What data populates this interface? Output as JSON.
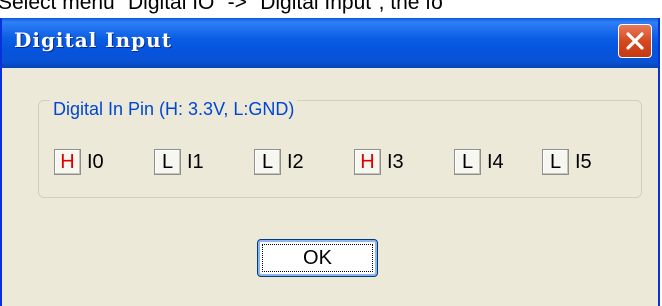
{
  "caption": {
    "text": "Select menu \"Digital IO\" -> \"Digital Input\", the fo"
  },
  "window": {
    "title": "Digital Input",
    "close_icon": "close-icon",
    "title_bar_color": "#0a5bd8",
    "body_color": "#ece9d8"
  },
  "group": {
    "legend": "Digital In Pin (H: 3.3V, L:GND)",
    "legend_color": "#0046d5",
    "pins": [
      {
        "state": "H",
        "label": "I0"
      },
      {
        "state": "L",
        "label": "I1"
      },
      {
        "state": "L",
        "label": "I2"
      },
      {
        "state": "H",
        "label": "I3"
      },
      {
        "state": "L",
        "label": "I4"
      },
      {
        "state": "L",
        "label": "I5"
      }
    ],
    "high_color": "#e00000"
  },
  "ok_button": {
    "label": "OK"
  }
}
